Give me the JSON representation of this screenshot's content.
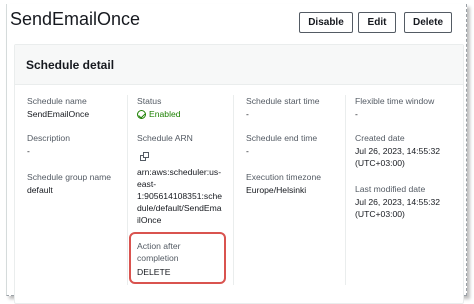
{
  "page": {
    "title": "SendEmailOnce"
  },
  "actions": {
    "disable": "Disable",
    "edit": "Edit",
    "delete": "Delete"
  },
  "panel": {
    "title": "Schedule detail"
  },
  "fields": {
    "schedule_name": {
      "label": "Schedule name",
      "value": "SendEmailOnce"
    },
    "description": {
      "label": "Description",
      "value": "-"
    },
    "schedule_group_name": {
      "label": "Schedule group name",
      "value": "default"
    },
    "status": {
      "label": "Status",
      "value": "Enabled",
      "color": "#1d8102"
    },
    "schedule_arn": {
      "label": "Schedule ARN",
      "value_lines": [
        "arn:aws:scheduler:us-",
        "east-",
        "1:905614108351:sche",
        "dule/default/SendEma",
        "ilOnce"
      ]
    },
    "action_after_completion": {
      "label_lines": [
        "Action after",
        "completion"
      ],
      "value": "DELETE"
    },
    "schedule_start_time": {
      "label": "Schedule start time",
      "value": "-"
    },
    "schedule_end_time": {
      "label": "Schedule end time",
      "value": "-"
    },
    "execution_timezone": {
      "label": "Execution timezone",
      "value": "Europe/Helsinki"
    },
    "flexible_time_window": {
      "label": "Flexible time window",
      "value": "-"
    },
    "created_date": {
      "label": "Created date",
      "value_lines": [
        "Jul 26, 2023, 14:55:32",
        "(UTC+03:00)"
      ]
    },
    "last_modified_date": {
      "label": "Last modified date",
      "value_lines": [
        "Jul 26, 2023, 14:55:32",
        "(UTC+03:00)"
      ]
    }
  },
  "icons": {
    "status": "check-circle-icon",
    "copy": "copy-icon"
  },
  "colors": {
    "highlight": "#d9534f",
    "success": "#1d8102"
  }
}
